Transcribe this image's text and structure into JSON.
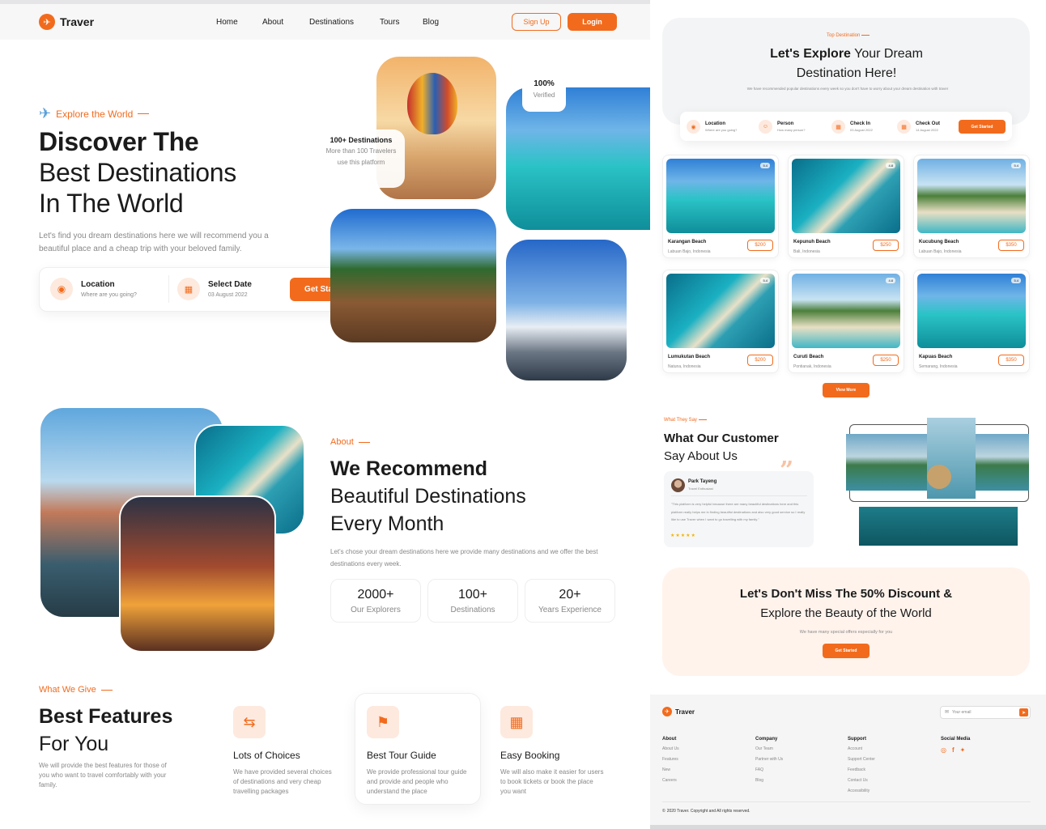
{
  "nav": {
    "brand": "Traver",
    "links": [
      "Home",
      "About",
      "Destinations",
      "Tours",
      "Blog"
    ],
    "signup": "Sign Up",
    "login": "Login"
  },
  "hero": {
    "kicker": "Explore the World",
    "title1": "Discover The",
    "title2": "Best Destinations",
    "title3": "In The World",
    "desc1": "Let's find you dream destinations here we will recommend you a",
    "desc2": "beautiful place and a cheap trip with your beloved family.",
    "location_label": "Location",
    "location_hint": "Where are you going?",
    "date_label": "Select Date",
    "date_value": "03 August 2022",
    "cta": "Get Started",
    "badge_dest_title": "100+ Destinations",
    "badge_dest_text": "More than 100 Travelers use this platform",
    "badge_verified_value": "100%",
    "badge_verified_text": "Verified"
  },
  "about": {
    "kicker": "About",
    "title1": "We Recommend",
    "title2": "Beautiful Destinations",
    "title3": "Every Month",
    "desc": "Let's chose your dream destinations here we provide many destinations and we offer the best destinations every week.",
    "stats": [
      {
        "value": "2000+",
        "label": "Our Explorers"
      },
      {
        "value": "100+",
        "label": "Destinations"
      },
      {
        "value": "20+",
        "label": "Years Experience"
      }
    ]
  },
  "features": {
    "kicker": "What We Give",
    "title1": "Best Features",
    "title2": "For You",
    "desc": "We will provide the best features for those of you who want to travel comfortably with your family.",
    "items": [
      {
        "title": "Lots of Choices",
        "desc": "We have provided several choices of destinations and very cheap travelling packages",
        "icon": "signpost-icon"
      },
      {
        "title": "Best Tour Guide",
        "desc": "We provide professional tour guide and provide and people who understand the place",
        "icon": "guide-icon"
      },
      {
        "title": "Easy Booking",
        "desc": "We will also make it easier for users to book tickets or book the place you want",
        "icon": "calendar-icon"
      }
    ]
  },
  "top": {
    "kicker": "Top Destination",
    "title_bold": "Let's Explore",
    "title_rest": "Your Dream",
    "title2": "Destination Here!",
    "desc": "We have recommended popular destinations every week so you don't have to worry about your dream destination with traver",
    "search": [
      {
        "label": "Location",
        "hint": "Where are you going?"
      },
      {
        "label": "Person",
        "hint": "How many person?"
      },
      {
        "label": "Check In",
        "hint": "03 August 2022"
      },
      {
        "label": "Check Out",
        "hint": "14 August 2022"
      }
    ],
    "cta": "Get Started",
    "view_more": "View More",
    "cards": [
      {
        "name": "Karangan Beach",
        "loc": "Labuan Bajo, Indonesia",
        "price": "$200",
        "rating": "5.4"
      },
      {
        "name": "Kepunuh Beach",
        "loc": "Bali, Indonesia",
        "price": "$250",
        "rating": "4.8"
      },
      {
        "name": "Kucubung Beach",
        "loc": "Labuan Bajo, Indonesia",
        "price": "$350",
        "rating": "5.4"
      },
      {
        "name": "Lumukutan Beach",
        "loc": "Natuna, Indonesia",
        "price": "$200",
        "rating": "5.4"
      },
      {
        "name": "Curuti Beach",
        "loc": "Pontianak, Indonesia",
        "price": "$250",
        "rating": "4.8"
      },
      {
        "name": "Kapuas Beach",
        "loc": "Semarang, Indonesia",
        "price": "$350",
        "rating": "5.4"
      }
    ]
  },
  "testimonial": {
    "kicker": "What They Say",
    "title1": "What Our Customer",
    "title2": "Say About Us",
    "name": "Park Tayeng",
    "role": "Travel Enthusiast",
    "quote": "\"This platform is very helpful because there are many beautiful destinations here and this platform really helps me in finding beautiful destinations and also very good service so I really like to use Traver when I want to go travelling with my family.\"",
    "stars": "★★★★★"
  },
  "promo": {
    "title1": "Let's Don't Miss The 50% Discount &",
    "title2": "Explore the Beauty of the World",
    "desc": "We have many special offers especially for you",
    "cta": "Get Started"
  },
  "footer": {
    "brand": "Traver",
    "email_placeholder": "Your email",
    "cols": [
      {
        "h": "About",
        "items": [
          "About Us",
          "Features",
          "New",
          "Careers"
        ]
      },
      {
        "h": "Company",
        "items": [
          "Our Team",
          "Partner with Us",
          "FAQ",
          "Blog"
        ]
      },
      {
        "h": "Support",
        "items": [
          "Account",
          "Support Center",
          "Feedback",
          "Contact Us",
          "Accessibility"
        ]
      },
      {
        "h": "Social Media",
        "items": []
      }
    ],
    "copyright": "2020 Traver. Copyright and All rights reserved."
  },
  "colors": {
    "accent": "#f26b1d",
    "soft": "#fde9de"
  }
}
